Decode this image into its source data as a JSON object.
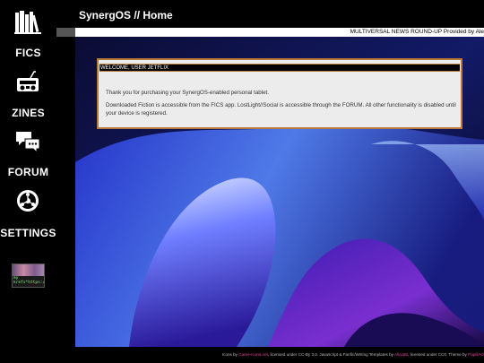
{
  "window": {
    "title": "SynergOS // Home"
  },
  "ticker": {
    "text": "MULTIVERSAL NEWS ROUND-UP Provided by Ale"
  },
  "sidebar": {
    "items": [
      {
        "label": "FICS",
        "icon": "radio-icon"
      },
      {
        "label": "ZINES",
        "icon": "speech-bubbles-icon"
      },
      {
        "label": "FORUM",
        "icon": "network-icon"
      },
      {
        "label": "SETTINGS",
        "icon": ""
      }
    ],
    "badge": {
      "text": "my\nkrefs*https:/"
    }
  },
  "dialog": {
    "header": "WELCOME, USER JETFLIX",
    "paragraph1": "Thank you for purchasing your SynergOS-enabled personal tablet.",
    "paragraph2": "Downloaded Fiction is accessible from the FICS app. LostLight//Social is accessible through the FORUM. All other functionality is disabled until your device is registered."
  },
  "footer": {
    "p1": "Icons by ",
    "l1": "Game-Icons.net",
    "p2": ", licensed under CC-By 3.0. Javascript & Fanfic/Writing Templates by ",
    "l2": "AliciaBi",
    "p3": ", licensed under CC0. Theme by ",
    "l3": "PapillAO"
  },
  "colors": {
    "accent_border": "#b9793a",
    "footer_link": "#e0469a"
  }
}
